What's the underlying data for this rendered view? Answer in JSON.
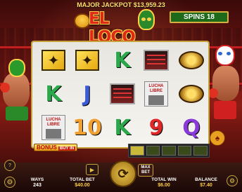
{
  "header": {
    "jackpot_label": "MAJOR JACKPOT",
    "jackpot_value": "$13,959.23",
    "logo_text": "EL LOCO",
    "spins_label": "SPINS 18"
  },
  "reels": {
    "columns": [
      [
        "wild",
        "K",
        "poster"
      ],
      [
        "wild",
        "J",
        "10"
      ],
      [
        "K",
        "ring",
        "K"
      ],
      [
        "ring",
        "poster",
        "9"
      ],
      [
        "belt",
        "belt",
        "Q"
      ]
    ]
  },
  "poster_text": {
    "line1": "LUCHA",
    "line2": "LIBRE"
  },
  "bonus": {
    "label": "BONUS",
    "buy": "BUY IN"
  },
  "footer": {
    "ways_label": "WAYS",
    "ways_value": "243",
    "total_bet_label": "TOTAL BET",
    "total_bet_value": "$40.00",
    "total_win_label": "TOTAL WIN",
    "total_win_value": "$6.00",
    "balance_label": "BALANCE",
    "balance_value": "$7.40",
    "max_bet_label": "MAX BET",
    "menu_icon": "help-icon",
    "settings_icon": "gear-icon"
  },
  "colors": {
    "accent": "#e8c34a",
    "reel_bg": "#efeee9",
    "spins_bg": "#1d6a1a",
    "k_green": "#2aa84a",
    "j_blue": "#3a5ad8",
    "ten_orange": "#f0a030",
    "nine_red": "#e02828",
    "q_purple": "#8a3ad8"
  }
}
